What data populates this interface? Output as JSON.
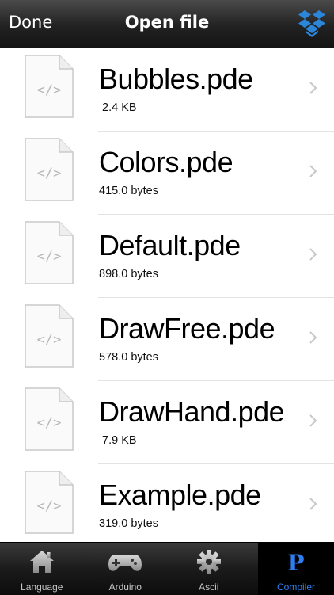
{
  "header": {
    "done_label": "Done",
    "title": "Open file",
    "dropbox_icon": "dropbox-icon"
  },
  "files": [
    {
      "name": "Bubbles.pde",
      "size": " 2.4 KB",
      "icon": "code-file-icon"
    },
    {
      "name": "Colors.pde",
      "size": "415.0 bytes",
      "icon": "code-file-icon"
    },
    {
      "name": "Default.pde",
      "size": "898.0 bytes",
      "icon": "code-file-icon"
    },
    {
      "name": "DrawFree.pde",
      "size": "578.0 bytes",
      "icon": "code-file-icon"
    },
    {
      "name": "DrawHand.pde",
      "size": " 7.9 KB",
      "icon": "code-file-icon"
    },
    {
      "name": "Example.pde",
      "size": "319.0 bytes",
      "icon": "code-file-icon"
    }
  ],
  "tabs": [
    {
      "label": "Language",
      "icon": "home-icon"
    },
    {
      "label": "Arduino",
      "icon": "gamepad-icon"
    },
    {
      "label": "Ascii",
      "icon": "gear-icon"
    },
    {
      "label": "Compiler",
      "icon": "processing-p-icon",
      "active": true
    }
  ],
  "colors": {
    "tab_active_label": "#2f7df0",
    "dropbox_blue": "#2b86d9"
  }
}
